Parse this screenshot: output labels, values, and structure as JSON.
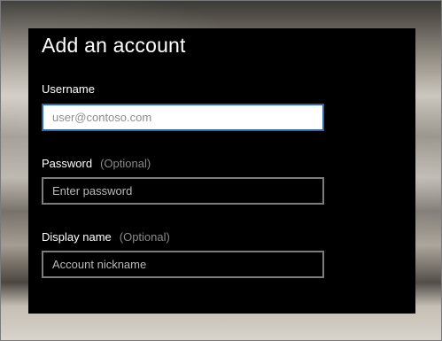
{
  "dialog": {
    "title": "Add an account"
  },
  "fields": {
    "username": {
      "label": "Username",
      "value": "",
      "placeholder": "user@contoso.com"
    },
    "password": {
      "label": "Password",
      "optional": "(Optional)",
      "value": "",
      "placeholder": "Enter password"
    },
    "display_name": {
      "label": "Display name",
      "optional": "(Optional)",
      "value": "",
      "placeholder": "Account nickname"
    }
  },
  "colors": {
    "dialog_background": "#000000",
    "focus_border": "#2b6aa8",
    "input_border": "#7c7c7c",
    "optional_text": "#8a8a8a"
  }
}
